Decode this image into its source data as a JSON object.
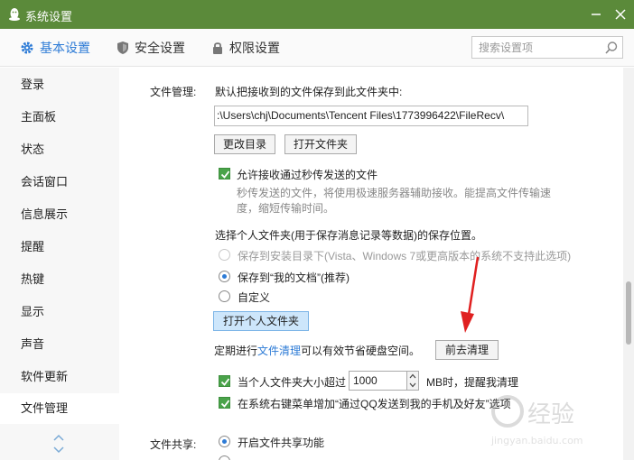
{
  "window": {
    "title": "系统设置"
  },
  "tabs": [
    {
      "label": "基本设置",
      "icon": "gear-icon",
      "active": true
    },
    {
      "label": "安全设置",
      "icon": "shield-icon",
      "active": false
    },
    {
      "label": "权限设置",
      "icon": "lock-icon",
      "active": false
    }
  ],
  "search": {
    "placeholder": "搜索设置项"
  },
  "sidebar": {
    "items": [
      {
        "label": "登录"
      },
      {
        "label": "主面板"
      },
      {
        "label": "状态"
      },
      {
        "label": "会话窗口"
      },
      {
        "label": "信息展示"
      },
      {
        "label": "提醒"
      },
      {
        "label": "热键"
      },
      {
        "label": "显示"
      },
      {
        "label": "声音"
      },
      {
        "label": "软件更新"
      },
      {
        "label": "文件管理",
        "active": true
      }
    ]
  },
  "file_management": {
    "section_label": "文件管理:",
    "save_desc": "默认把接收到的文件保存到此文件夹中:",
    "path": ":\\Users\\chj\\Documents\\Tencent Files\\1773996422\\FileRecv\\",
    "change_dir_button": "更改目录",
    "open_folder_button": "打开文件夹",
    "allow_flash_label": "允许接收通过秒传发送的文件",
    "allow_flash_desc_1": "秒传发送的文件，将使用极速服务器辅助接收。能提高文件传输速",
    "allow_flash_desc_2": "度，缩短传输时间。",
    "personal_folder_desc": "选择个人文件夹(用于保存消息记录等数据)的保存位置。",
    "option_install_dir": "保存到安装目录下(Vista、Windows 7或更高版本的系统不支持此选项)",
    "option_my_documents": "保存到“我的文档”(推荐)",
    "option_custom": "自定义",
    "open_personal_folder_button": "打开个人文件夹",
    "cleanup_prefix": "定期进行",
    "cleanup_link": "文件清理",
    "cleanup_suffix": "可以有效节省硬盘空间。",
    "goto_cleanup_button": "前去清理",
    "size_prefix": "当个人文件夹大小超过",
    "size_value": "1000",
    "size_suffix": "MB时，提醒我清理",
    "context_menu_label": "在系统右键菜单增加“通过QQ发送到我的手机及好友”选项"
  },
  "file_sharing": {
    "section_label": "文件共享:",
    "enable_label": "开启文件共享功能"
  },
  "watermark": {
    "text": "经验",
    "subtext": "jingyan.baidu.com"
  },
  "colors": {
    "titlebar": "#5b8a3a",
    "accent": "#2d7bd6",
    "checkbox": "#4aa34a",
    "annotation_arrow": "#e02020"
  }
}
